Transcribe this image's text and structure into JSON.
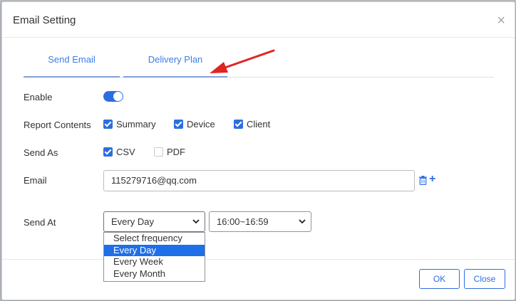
{
  "dialog": {
    "title": "Email Setting",
    "close_icon": "close-icon"
  },
  "tabs": [
    {
      "label": "Send Email",
      "active": false
    },
    {
      "label": "Delivery Plan",
      "active": true
    }
  ],
  "annotation": {
    "arrow_color": "#e02424"
  },
  "form": {
    "enable": {
      "label": "Enable",
      "on": true
    },
    "report_contents": {
      "label": "Report Contents",
      "options": [
        {
          "label": "Summary",
          "checked": true
        },
        {
          "label": "Device",
          "checked": true
        },
        {
          "label": "Client",
          "checked": true
        }
      ]
    },
    "send_as": {
      "label": "Send As",
      "options": [
        {
          "label": "CSV",
          "checked": true
        },
        {
          "label": "PDF",
          "checked": false
        }
      ]
    },
    "email": {
      "label": "Email",
      "value": "115279716@qq.com",
      "delete_icon": "trash-icon",
      "add_icon": "plus-icon"
    },
    "send_at": {
      "label": "Send At",
      "frequency_value": "Every Day",
      "time_value": "16:00~16:59",
      "frequency_options": [
        "Select frequency",
        "Every Day",
        "Every Week",
        "Every Month"
      ],
      "selected_option": "Every Day"
    }
  },
  "footer": {
    "ok_label": "OK",
    "close_label": "Close"
  },
  "colors": {
    "accent": "#2c6ee0",
    "tab_text": "#3d7ce5",
    "selected_option": "#1e6fe8"
  }
}
